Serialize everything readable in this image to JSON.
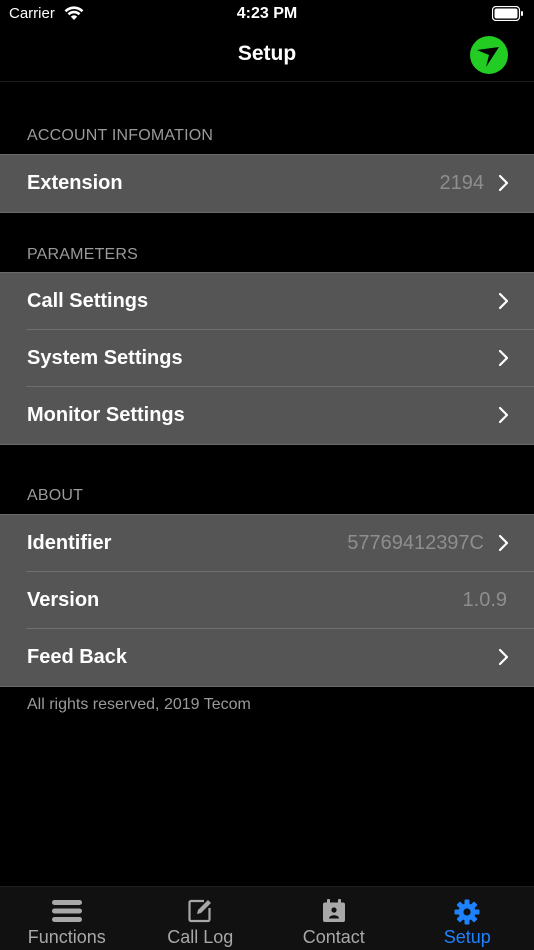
{
  "status": {
    "carrier": "Carrier",
    "time": "4:23 PM"
  },
  "nav": {
    "title": "Setup"
  },
  "sections": {
    "account": {
      "header": "ACCOUNT INFOMATION",
      "extension": {
        "label": "Extension",
        "value": "2194"
      }
    },
    "parameters": {
      "header": "PARAMETERS",
      "call_settings": {
        "label": "Call Settings"
      },
      "system_settings": {
        "label": "System Settings"
      },
      "monitor_settings": {
        "label": "Monitor Settings"
      }
    },
    "about": {
      "header": "ABOUT",
      "identifier": {
        "label": "Identifier",
        "value": "57769412397C"
      },
      "version": {
        "label": "Version",
        "value": "1.0.9"
      },
      "feedback": {
        "label": "Feed Back"
      }
    }
  },
  "footer": "All rights reserved, 2019 Tecom",
  "tabs": [
    {
      "label": "Functions",
      "icon": "menu-icon",
      "active": false
    },
    {
      "label": "Call Log",
      "icon": "edit-icon",
      "active": false
    },
    {
      "label": "Contact",
      "icon": "contact-icon",
      "active": false
    },
    {
      "label": "Setup",
      "icon": "gear-icon",
      "active": true
    }
  ],
  "colors": {
    "accent": "#1e82ff",
    "logo": "#22cc22",
    "row_bg": "#555555"
  }
}
